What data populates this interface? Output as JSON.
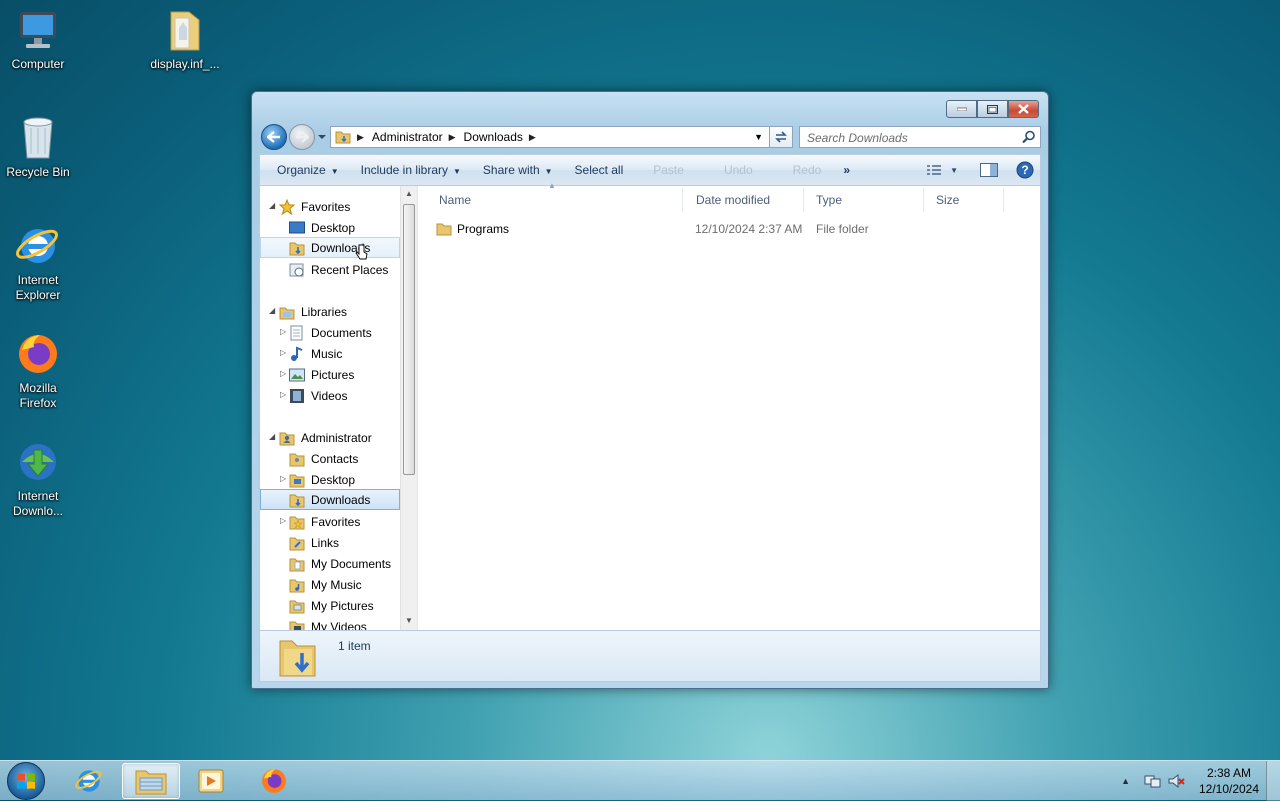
{
  "desktop": {
    "icons": [
      {
        "label": "Computer"
      },
      {
        "label": "display.inf_..."
      },
      {
        "label": "Recycle Bin"
      },
      {
        "label": "Internet Explorer"
      },
      {
        "label": "Mozilla Firefox"
      },
      {
        "label": "Internet Downlo..."
      }
    ]
  },
  "window": {
    "address": {
      "crumbs": [
        "Administrator",
        "Downloads"
      ]
    },
    "search_placeholder": "Search Downloads",
    "toolbar": {
      "organize": "Organize",
      "include_library": "Include in library",
      "share_with": "Share with",
      "select_all": "Select all",
      "paste": "Paste",
      "undo": "Undo",
      "redo": "Redo",
      "more": "»"
    },
    "nav": {
      "favorites": "Favorites",
      "fav_desktop": "Desktop",
      "fav_downloads": "Downloads",
      "fav_recent": "Recent Places",
      "libraries": "Libraries",
      "lib_documents": "Documents",
      "lib_music": "Music",
      "lib_pictures": "Pictures",
      "lib_videos": "Videos",
      "administrator": "Administrator",
      "adm_contacts": "Contacts",
      "adm_desktop": "Desktop",
      "adm_downloads": "Downloads",
      "adm_favorites": "Favorites",
      "adm_links": "Links",
      "adm_mydocuments": "My Documents",
      "adm_mymusic": "My Music",
      "adm_mypictures": "My Pictures",
      "adm_myvideos": "My Videos"
    },
    "columns": {
      "name": "Name",
      "date": "Date modified",
      "type": "Type",
      "size": "Size"
    },
    "files": [
      {
        "name": "Programs",
        "date": "12/10/2024 2:37 AM",
        "type": "File folder",
        "size": ""
      }
    ],
    "status": "1 item"
  },
  "taskbar": {
    "time": "2:38 AM",
    "date": "12/10/2024"
  },
  "colors": {
    "accent": "#1e395b",
    "selection": "#cee3f8"
  }
}
